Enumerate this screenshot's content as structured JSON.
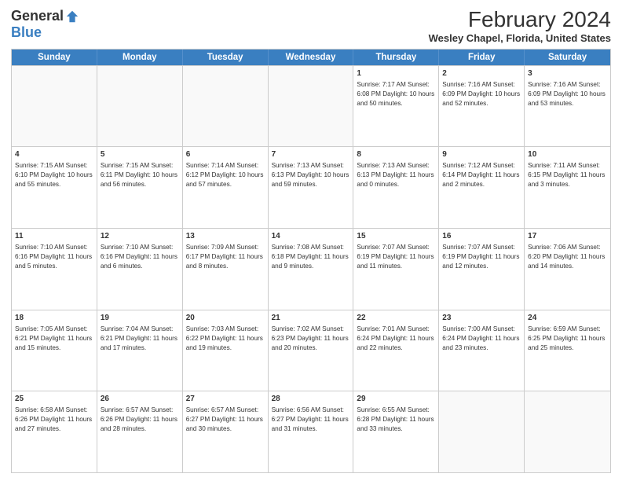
{
  "logo": {
    "general": "General",
    "blue": "Blue"
  },
  "header": {
    "title": "February 2024",
    "subtitle": "Wesley Chapel, Florida, United States"
  },
  "days_of_week": [
    "Sunday",
    "Monday",
    "Tuesday",
    "Wednesday",
    "Thursday",
    "Friday",
    "Saturday"
  ],
  "weeks": [
    [
      {
        "day": "",
        "info": ""
      },
      {
        "day": "",
        "info": ""
      },
      {
        "day": "",
        "info": ""
      },
      {
        "day": "",
        "info": ""
      },
      {
        "day": "1",
        "info": "Sunrise: 7:17 AM\nSunset: 6:08 PM\nDaylight: 10 hours and 50 minutes."
      },
      {
        "day": "2",
        "info": "Sunrise: 7:16 AM\nSunset: 6:09 PM\nDaylight: 10 hours and 52 minutes."
      },
      {
        "day": "3",
        "info": "Sunrise: 7:16 AM\nSunset: 6:09 PM\nDaylight: 10 hours and 53 minutes."
      }
    ],
    [
      {
        "day": "4",
        "info": "Sunrise: 7:15 AM\nSunset: 6:10 PM\nDaylight: 10 hours and 55 minutes."
      },
      {
        "day": "5",
        "info": "Sunrise: 7:15 AM\nSunset: 6:11 PM\nDaylight: 10 hours and 56 minutes."
      },
      {
        "day": "6",
        "info": "Sunrise: 7:14 AM\nSunset: 6:12 PM\nDaylight: 10 hours and 57 minutes."
      },
      {
        "day": "7",
        "info": "Sunrise: 7:13 AM\nSunset: 6:13 PM\nDaylight: 10 hours and 59 minutes."
      },
      {
        "day": "8",
        "info": "Sunrise: 7:13 AM\nSunset: 6:13 PM\nDaylight: 11 hours and 0 minutes."
      },
      {
        "day": "9",
        "info": "Sunrise: 7:12 AM\nSunset: 6:14 PM\nDaylight: 11 hours and 2 minutes."
      },
      {
        "day": "10",
        "info": "Sunrise: 7:11 AM\nSunset: 6:15 PM\nDaylight: 11 hours and 3 minutes."
      }
    ],
    [
      {
        "day": "11",
        "info": "Sunrise: 7:10 AM\nSunset: 6:16 PM\nDaylight: 11 hours and 5 minutes."
      },
      {
        "day": "12",
        "info": "Sunrise: 7:10 AM\nSunset: 6:16 PM\nDaylight: 11 hours and 6 minutes."
      },
      {
        "day": "13",
        "info": "Sunrise: 7:09 AM\nSunset: 6:17 PM\nDaylight: 11 hours and 8 minutes."
      },
      {
        "day": "14",
        "info": "Sunrise: 7:08 AM\nSunset: 6:18 PM\nDaylight: 11 hours and 9 minutes."
      },
      {
        "day": "15",
        "info": "Sunrise: 7:07 AM\nSunset: 6:19 PM\nDaylight: 11 hours and 11 minutes."
      },
      {
        "day": "16",
        "info": "Sunrise: 7:07 AM\nSunset: 6:19 PM\nDaylight: 11 hours and 12 minutes."
      },
      {
        "day": "17",
        "info": "Sunrise: 7:06 AM\nSunset: 6:20 PM\nDaylight: 11 hours and 14 minutes."
      }
    ],
    [
      {
        "day": "18",
        "info": "Sunrise: 7:05 AM\nSunset: 6:21 PM\nDaylight: 11 hours and 15 minutes."
      },
      {
        "day": "19",
        "info": "Sunrise: 7:04 AM\nSunset: 6:21 PM\nDaylight: 11 hours and 17 minutes."
      },
      {
        "day": "20",
        "info": "Sunrise: 7:03 AM\nSunset: 6:22 PM\nDaylight: 11 hours and 19 minutes."
      },
      {
        "day": "21",
        "info": "Sunrise: 7:02 AM\nSunset: 6:23 PM\nDaylight: 11 hours and 20 minutes."
      },
      {
        "day": "22",
        "info": "Sunrise: 7:01 AM\nSunset: 6:24 PM\nDaylight: 11 hours and 22 minutes."
      },
      {
        "day": "23",
        "info": "Sunrise: 7:00 AM\nSunset: 6:24 PM\nDaylight: 11 hours and 23 minutes."
      },
      {
        "day": "24",
        "info": "Sunrise: 6:59 AM\nSunset: 6:25 PM\nDaylight: 11 hours and 25 minutes."
      }
    ],
    [
      {
        "day": "25",
        "info": "Sunrise: 6:58 AM\nSunset: 6:26 PM\nDaylight: 11 hours and 27 minutes."
      },
      {
        "day": "26",
        "info": "Sunrise: 6:57 AM\nSunset: 6:26 PM\nDaylight: 11 hours and 28 minutes."
      },
      {
        "day": "27",
        "info": "Sunrise: 6:57 AM\nSunset: 6:27 PM\nDaylight: 11 hours and 30 minutes."
      },
      {
        "day": "28",
        "info": "Sunrise: 6:56 AM\nSunset: 6:27 PM\nDaylight: 11 hours and 31 minutes."
      },
      {
        "day": "29",
        "info": "Sunrise: 6:55 AM\nSunset: 6:28 PM\nDaylight: 11 hours and 33 minutes."
      },
      {
        "day": "",
        "info": ""
      },
      {
        "day": "",
        "info": ""
      }
    ]
  ],
  "colors": {
    "header_bg": "#3a7fc1",
    "header_text": "#ffffff",
    "border": "#cccccc",
    "empty_bg": "#f9f9f9"
  }
}
